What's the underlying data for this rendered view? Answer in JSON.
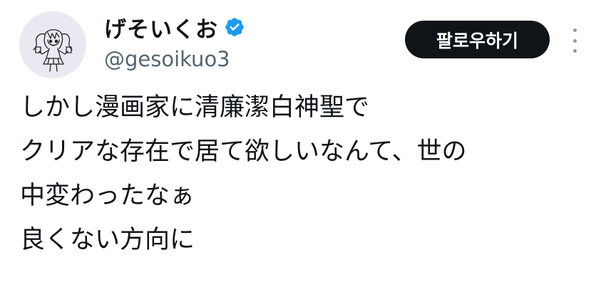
{
  "author": {
    "display_name": "げそいくお",
    "handle": "@gesoikuo3",
    "verified": true,
    "avatar_icon": "anime-girl-sketch-avatar",
    "verified_icon": "verified-badge-icon",
    "verified_color": "#1d9bf0"
  },
  "actions": {
    "follow_label": "팔로우하기",
    "more_icon": "more-options-vertical-icon"
  },
  "tweet": {
    "lines": [
      "しかし漫画家に清廉潔白神聖で",
      "クリアな存在で居て欲しいなんて、世の",
      "中変わったなぁ",
      "良くない方向に"
    ]
  }
}
